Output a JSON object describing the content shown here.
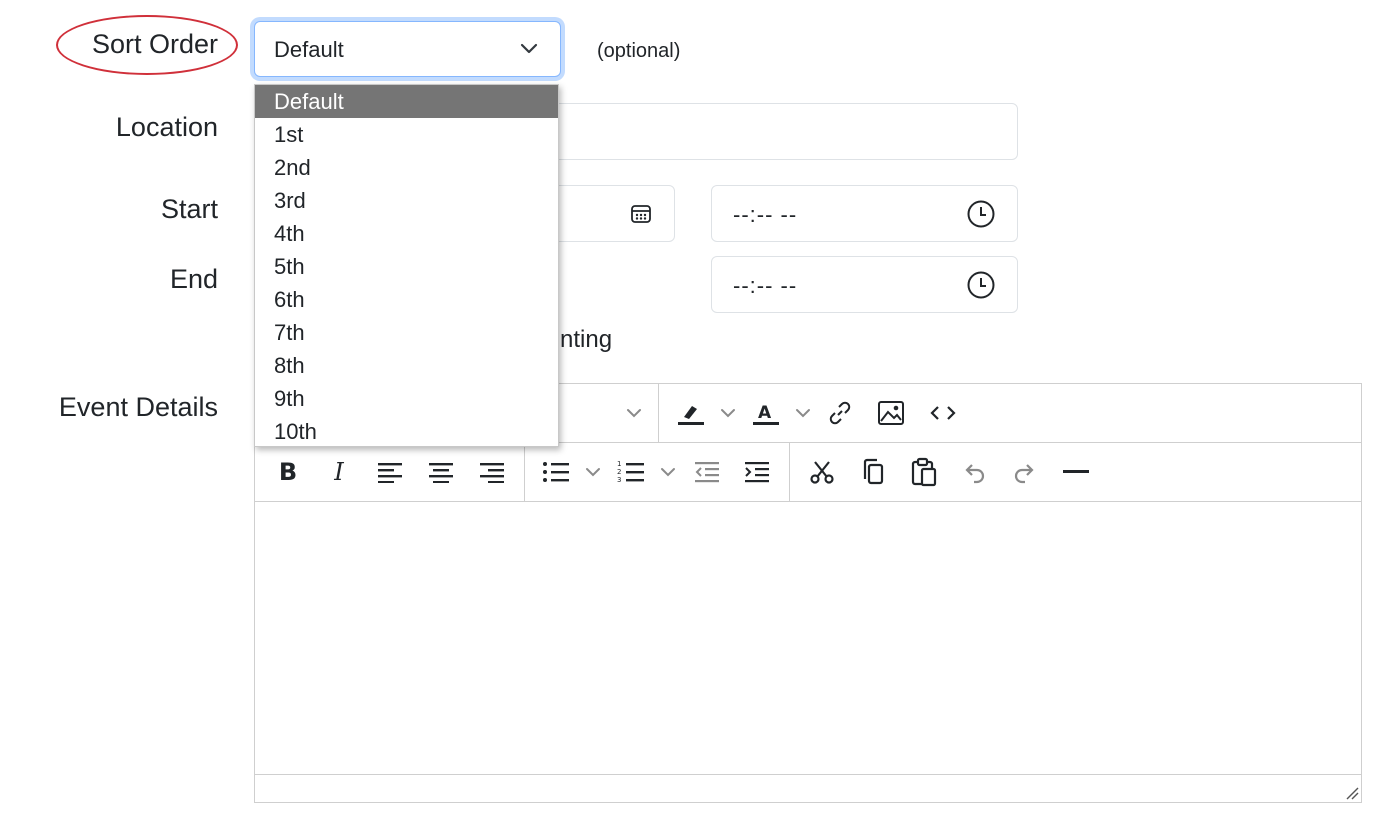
{
  "form": {
    "sort_order_label": "Sort Order",
    "location_label": "Location",
    "start_label": "Start",
    "end_label": "End",
    "event_details_label": "Event Details",
    "optional_hint": "(optional)",
    "partial_checkbox_text": "nting"
  },
  "sort_select": {
    "selected": "Default",
    "options": [
      "Default",
      "1st",
      "2nd",
      "3rd",
      "4th",
      "5th",
      "6th",
      "7th",
      "8th",
      "9th",
      "10th"
    ]
  },
  "time_inputs": {
    "start_time": "--:-- --",
    "end_time": "--:-- --"
  },
  "editor": {
    "toolbar_row1": [
      "chevron-down-icon",
      "highlight-icon",
      "font-color-icon",
      "link-icon",
      "image-icon",
      "code-icon"
    ],
    "toolbar_row2": [
      "bold-icon",
      "italic-icon",
      "align-left-icon",
      "align-center-icon",
      "align-right-icon",
      "bullet-list-icon",
      "numbered-list-icon",
      "outdent-icon",
      "indent-icon",
      "cut-icon",
      "copy-icon",
      "paste-icon",
      "undo-icon",
      "redo-icon",
      "horizontal-rule-icon"
    ]
  },
  "colors": {
    "focus_border": "#86b7fe",
    "annotation": "#d0303a",
    "selected_option_bg": "#757575"
  }
}
